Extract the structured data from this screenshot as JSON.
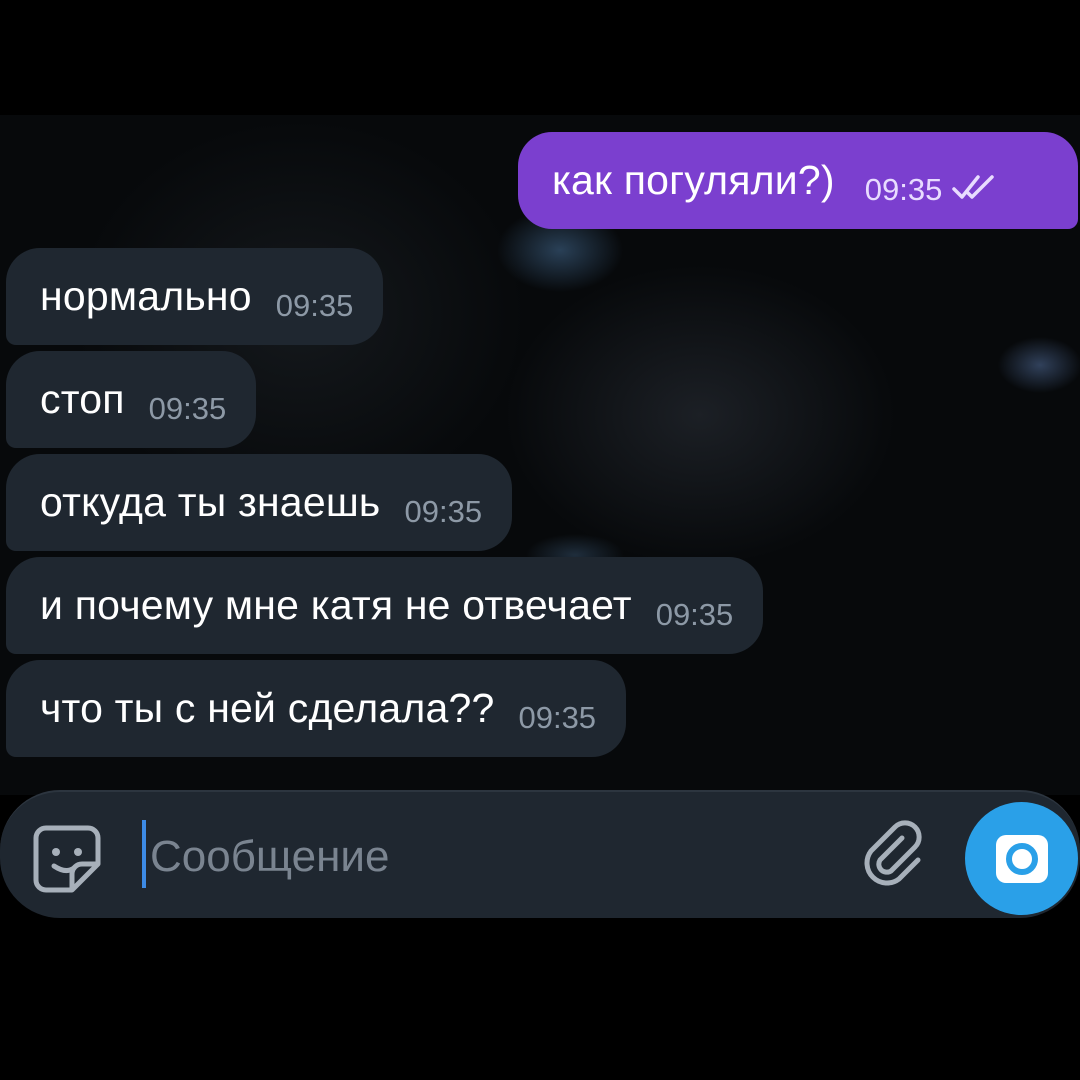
{
  "chat": {
    "outgoing": [
      {
        "text": "как погуляли?)",
        "time": "09:35",
        "status": "read"
      }
    ],
    "incoming": [
      {
        "text": "нормально",
        "time": "09:35"
      },
      {
        "text": "стоп",
        "time": "09:35"
      },
      {
        "text": "откуда ты знаешь",
        "time": "09:35"
      },
      {
        "text": "и почему мне катя не отвечает",
        "time": "09:35"
      },
      {
        "text": "что ты с ней сделала??",
        "time": "09:35"
      }
    ]
  },
  "composer": {
    "placeholder": "Сообщение",
    "value": "",
    "icons": {
      "sticker": "sticker-icon",
      "attach": "paperclip-icon",
      "camera": "camera-icon"
    }
  },
  "colors": {
    "outgoing_bubble": "#7b3fcf",
    "incoming_bubble": "#1f2730",
    "accent": "#2aa0e8"
  }
}
